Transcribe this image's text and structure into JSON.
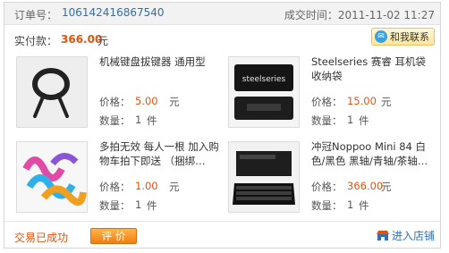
{
  "header": {
    "order_no_label": "订单号：",
    "order_no": "106142416867540",
    "deal_time_label": "成交时间：",
    "deal_time": "2011-11-02 11:27"
  },
  "summary": {
    "paid_label": "实付款：",
    "paid_amount": "366.00",
    "paid_unit": "元",
    "contact_label": "和我联系",
    "contact_icon": "chat-icon"
  },
  "items": [
    {
      "title": "机械键盘拔键器 通用型",
      "price_label": "价格：",
      "price": "5.00",
      "price_unit": "元",
      "qty_label": "数量：",
      "qty": "1",
      "qty_unit": "件"
    },
    {
      "title": "Steelseries  赛睿 耳机袋 收纳袋",
      "price_label": "价格：",
      "price": "15.00",
      "price_unit": "元",
      "qty_label": "数量：",
      "qty": "1",
      "qty_unit": "件"
    },
    {
      "title": "多拍无效 每人一根 加入购物车拍下即送 （捆绑…",
      "price_label": "价格：",
      "price": "1.00",
      "price_unit": "元",
      "qty_label": "数量：",
      "qty": "1",
      "qty_unit": "件"
    },
    {
      "title": "冲冠Noppoo Mini 84 白色/黑色 黑轴/青轴/茶轴…",
      "price_label": "价格：",
      "price": "366.00",
      "price_unit": "元",
      "qty_label": "数量：",
      "qty": "1",
      "qty_unit": "件"
    }
  ],
  "footer": {
    "status": "交易已成功",
    "rate_label": "评 价",
    "shop_label": "进入店铺",
    "shop_icon": "shop-icon"
  },
  "colors": {
    "accent": "#e4530e",
    "link": "#2f6fb5",
    "rate_button": "#f07e12"
  }
}
